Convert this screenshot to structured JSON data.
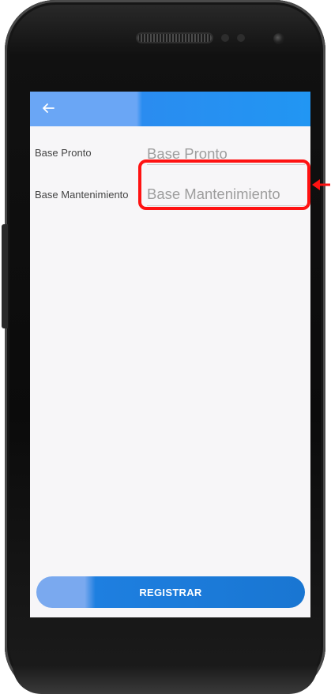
{
  "app": {
    "back_icon": "arrow-left-icon"
  },
  "form": {
    "fields": [
      {
        "label": "Base Pronto",
        "placeholder": "Base Pronto"
      },
      {
        "label": "Base Mantenimiento",
        "placeholder": "Base Mantenimiento"
      }
    ]
  },
  "actions": {
    "register_label": "REGISTRAR"
  },
  "colors": {
    "appbar": "#2196f3",
    "button": "#1976d2",
    "highlight": "#ff1212"
  }
}
